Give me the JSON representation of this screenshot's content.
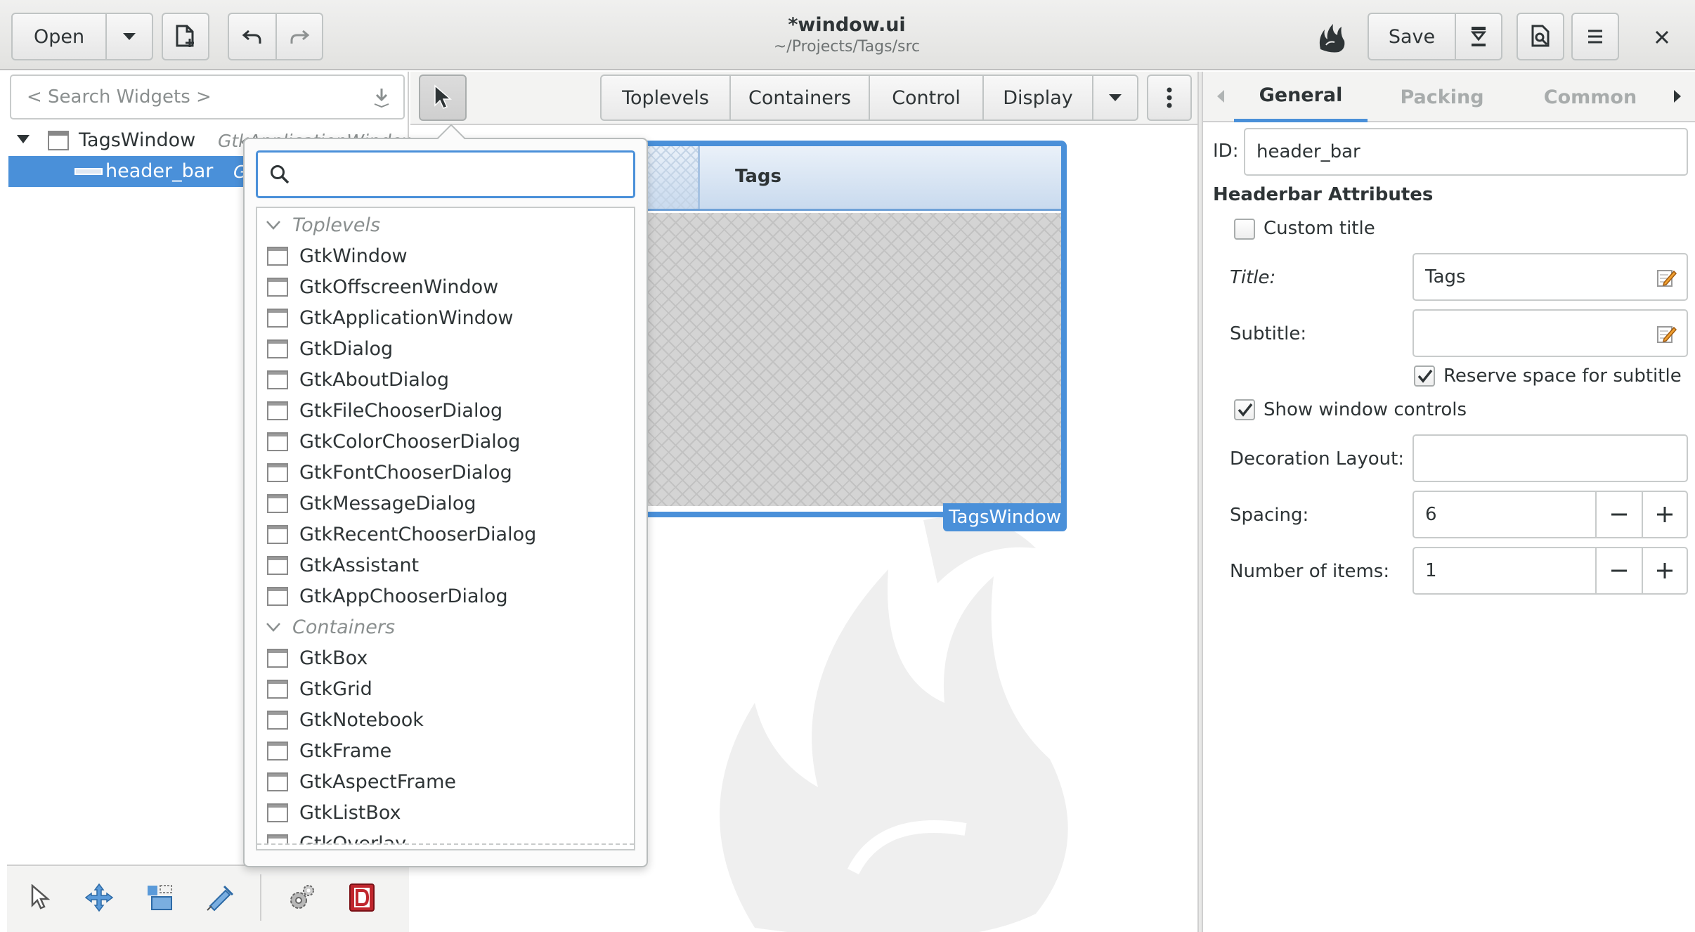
{
  "headerbar": {
    "open_label": "Open",
    "title": "*window.ui",
    "subtitle": "~/Projects/Tags/src",
    "save_label": "Save"
  },
  "palette": {
    "search_placeholder": "< Search Widgets >",
    "tabs": [
      "Toplevels",
      "Containers",
      "Control",
      "Display"
    ]
  },
  "tree": {
    "rows": [
      {
        "name": "TagsWindow",
        "type": "GtkApplicationWindow"
      },
      {
        "name": "header_bar",
        "type": "GtkHeaderBar"
      }
    ]
  },
  "popover": {
    "toplevels_header": "Toplevels",
    "toplevels": [
      "GtkWindow",
      "GtkOffscreenWindow",
      "GtkApplicationWindow",
      "GtkDialog",
      "GtkAboutDialog",
      "GtkFileChooserDialog",
      "GtkColorChooserDialog",
      "GtkFontChooserDialog",
      "GtkMessageDialog",
      "GtkRecentChooserDialog",
      "GtkAssistant",
      "GtkAppChooserDialog"
    ],
    "containers_header": "Containers",
    "containers": [
      "GtkBox",
      "GtkGrid",
      "GtkNotebook",
      "GtkFrame",
      "GtkAspectFrame",
      "GtkListBox",
      "GtkOverlay"
    ]
  },
  "canvas": {
    "header_title": "Tags",
    "window_label": "TagsWindow"
  },
  "editor": {
    "tabs": [
      "General",
      "Packing",
      "Common"
    ],
    "active_tab": "General",
    "id_label": "ID:",
    "id_value": "header_bar",
    "section_title": "Headerbar Attributes",
    "custom_title_label": "Custom title",
    "custom_title_checked": false,
    "title_label": "Title:",
    "title_value": "Tags",
    "subtitle_label": "Subtitle:",
    "subtitle_value": "",
    "reserve_label": "Reserve space for subtitle",
    "reserve_checked": true,
    "show_controls_label": "Show window controls",
    "show_controls_checked": true,
    "decoration_label": "Decoration Layout:",
    "decoration_value": "",
    "spacing_label": "Spacing:",
    "spacing_value": "6",
    "items_label": "Number of items:",
    "items_value": "1"
  },
  "colors": {
    "accent": "#4a90d9",
    "selection": "#4a90d9",
    "window_border": "#4a90d9"
  }
}
